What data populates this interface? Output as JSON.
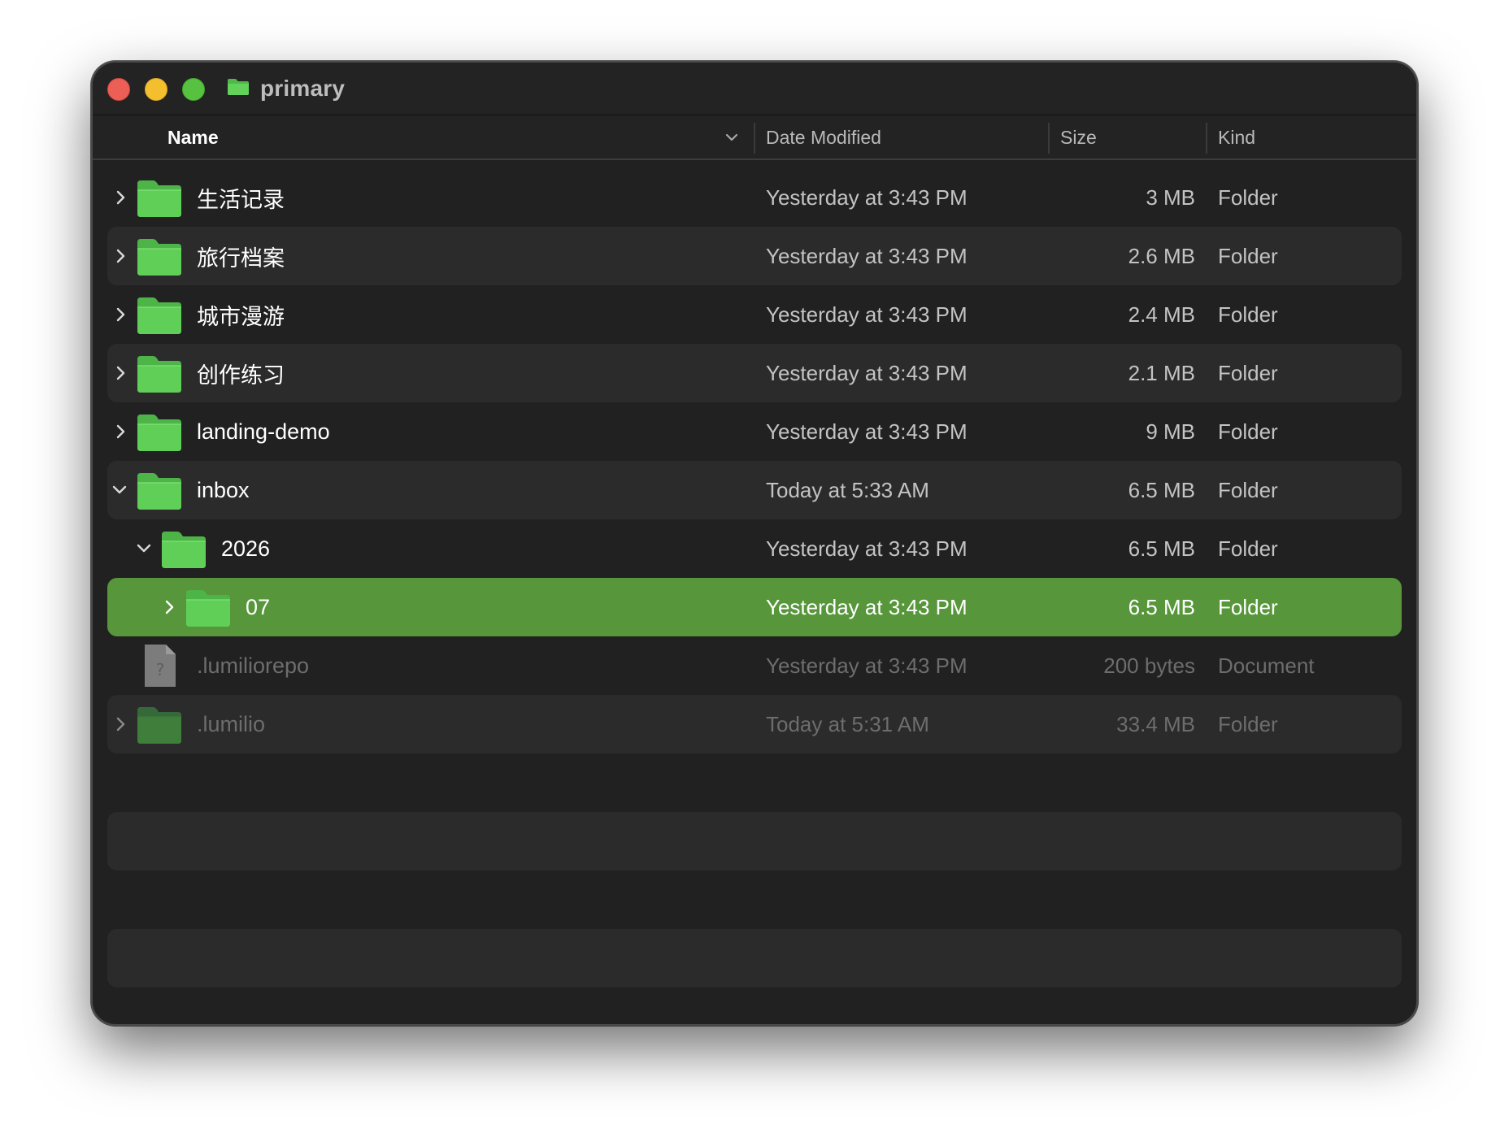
{
  "window": {
    "title": "primary",
    "title_icon": "folder-icon",
    "controls": [
      "close",
      "minimize",
      "zoom"
    ]
  },
  "columns": {
    "name": "Name",
    "date": "Date Modified",
    "size": "Size",
    "kind": "Kind",
    "sort_indicator": "chevron-down-icon"
  },
  "colors": {
    "folder": "#5fcf57",
    "selection": "#57963b",
    "window_bg": "#212121",
    "alt_row": "#2b2b2b"
  },
  "rows": [
    {
      "name": "生活记录",
      "date": "Yesterday at 3:43 PM",
      "size": "3 MB",
      "kind": "Folder",
      "icon": "folder-icon",
      "disclosure": "collapsed",
      "depth": 0,
      "selected": false,
      "hidden": false
    },
    {
      "name": "旅行档案",
      "date": "Yesterday at 3:43 PM",
      "size": "2.6 MB",
      "kind": "Folder",
      "icon": "folder-icon",
      "disclosure": "collapsed",
      "depth": 0,
      "selected": false,
      "hidden": false
    },
    {
      "name": "城市漫游",
      "date": "Yesterday at 3:43 PM",
      "size": "2.4 MB",
      "kind": "Folder",
      "icon": "folder-icon",
      "disclosure": "collapsed",
      "depth": 0,
      "selected": false,
      "hidden": false
    },
    {
      "name": "创作练习",
      "date": "Yesterday at 3:43 PM",
      "size": "2.1 MB",
      "kind": "Folder",
      "icon": "folder-icon",
      "disclosure": "collapsed",
      "depth": 0,
      "selected": false,
      "hidden": false
    },
    {
      "name": "landing-demo",
      "date": "Yesterday at 3:43 PM",
      "size": "9 MB",
      "kind": "Folder",
      "icon": "folder-icon",
      "disclosure": "collapsed",
      "depth": 0,
      "selected": false,
      "hidden": false
    },
    {
      "name": "inbox",
      "date": "Today at 5:33 AM",
      "size": "6.5 MB",
      "kind": "Folder",
      "icon": "folder-icon",
      "disclosure": "expanded",
      "depth": 0,
      "selected": false,
      "hidden": false
    },
    {
      "name": "2026",
      "date": "Yesterday at 3:43 PM",
      "size": "6.5 MB",
      "kind": "Folder",
      "icon": "folder-icon",
      "disclosure": "expanded",
      "depth": 1,
      "selected": false,
      "hidden": false
    },
    {
      "name": "07",
      "date": "Yesterday at 3:43 PM",
      "size": "6.5 MB",
      "kind": "Folder",
      "icon": "folder-icon",
      "disclosure": "collapsed",
      "depth": 2,
      "selected": true,
      "hidden": false
    },
    {
      "name": ".lumiliorepo",
      "date": "Yesterday at 3:43 PM",
      "size": "200 bytes",
      "kind": "Document",
      "icon": "document-icon",
      "disclosure": "none",
      "depth": 0,
      "selected": false,
      "hidden": true
    },
    {
      "name": ".lumilio",
      "date": "Today at 5:31 AM",
      "size": "33.4 MB",
      "kind": "Folder",
      "icon": "folder-icon",
      "disclosure": "collapsed",
      "depth": 0,
      "selected": false,
      "hidden": true
    }
  ],
  "empty_rows": 4
}
